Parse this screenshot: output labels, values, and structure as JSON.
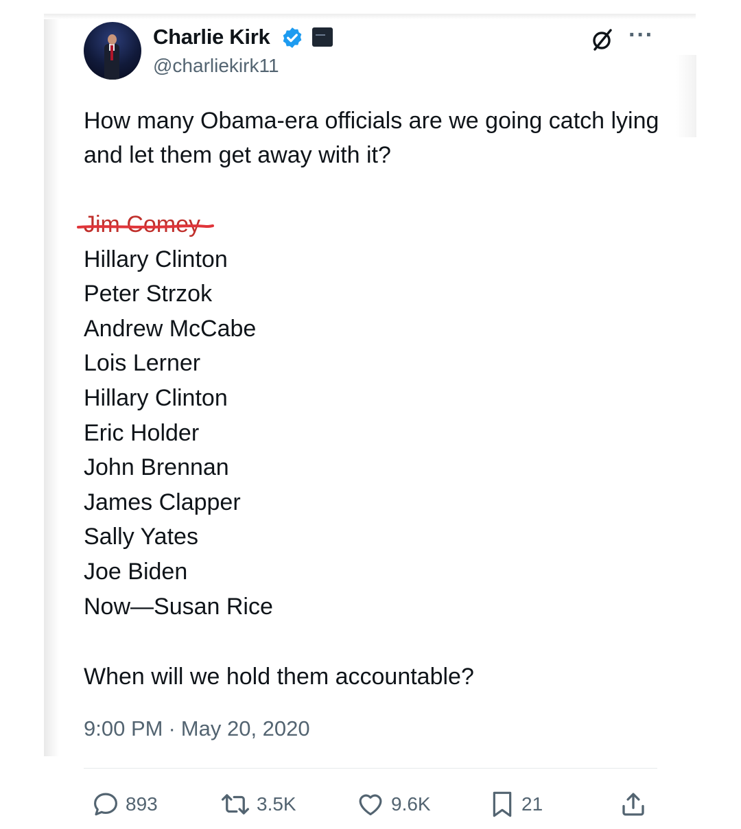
{
  "author": {
    "name": "Charlie Kirk",
    "handle": "@charliekirk11",
    "verified_color": "#1d9bf0"
  },
  "header_icons": {
    "grok": "grok-icon",
    "more": "···"
  },
  "tweet": {
    "intro": "How many Obama-era officials are we going catch lying and let them get away with it?",
    "names": [
      "Jim Comey",
      "Hillary Clinton",
      "Peter Strzok",
      "Andrew McCabe",
      "Lois Lerner",
      "Hillary Clinton",
      "Eric Holder",
      "John Brennan",
      "James Clapper",
      "Sally Yates",
      "Joe Biden",
      "Now—Susan Rice"
    ],
    "struck_name_index": 0,
    "strike_color": "#e0353a",
    "closing": "When will we hold them accountable?"
  },
  "timestamp": {
    "time": "9:00 PM",
    "separator": "·",
    "date": "May 20, 2020"
  },
  "actions": {
    "replies": "893",
    "retweets": "3.5K",
    "likes": "9.6K",
    "bookmarks": "21"
  }
}
